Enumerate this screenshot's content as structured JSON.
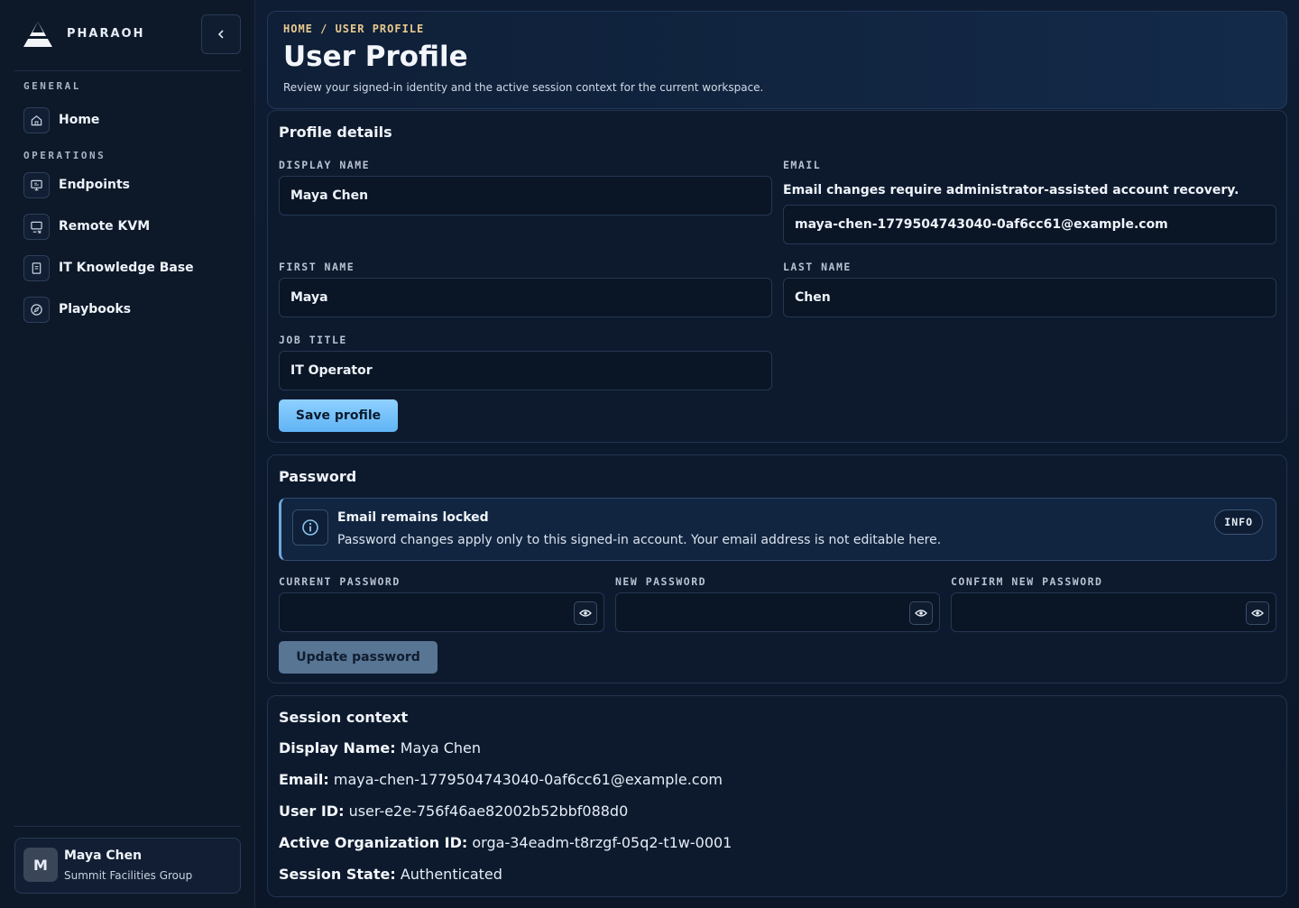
{
  "brand": {
    "name": "PHARAOH"
  },
  "sidebar": {
    "sections": [
      {
        "label": "GENERAL"
      },
      {
        "label": "OPERATIONS"
      }
    ],
    "items": [
      {
        "label": "Home",
        "icon": "home-icon"
      },
      {
        "label": "Endpoints",
        "icon": "monitor-icon"
      },
      {
        "label": "Remote KVM",
        "icon": "remote-screen-icon"
      },
      {
        "label": "IT Knowledge Base",
        "icon": "book-icon"
      },
      {
        "label": "Playbooks",
        "icon": "compass-icon"
      }
    ],
    "user": {
      "initial": "M",
      "name": "Maya Chen",
      "org": "Summit Facilities Group"
    }
  },
  "header": {
    "breadcrumb": "HOME / USER PROFILE",
    "title": "User Profile",
    "subtitle": "Review your signed-in identity and the active session context for the current workspace."
  },
  "profile": {
    "title": "Profile details",
    "display_name_label": "DISPLAY NAME",
    "display_name": "Maya Chen",
    "email_label": "EMAIL",
    "email_note": "Email changes require administrator-assisted account recovery.",
    "email": "maya-chen-1779504743040-0af6cc61@example.com",
    "first_name_label": "FIRST NAME",
    "first_name": "Maya",
    "last_name_label": "LAST NAME",
    "last_name": "Chen",
    "job_title_label": "JOB TITLE",
    "job_title": "IT Operator",
    "save_label": "Save profile"
  },
  "password": {
    "title": "Password",
    "alert_title": "Email remains locked",
    "alert_body": "Password changes apply only to this signed-in account. Your email address is not editable here.",
    "alert_badge": "INFO",
    "current_label": "CURRENT PASSWORD",
    "new_label": "NEW PASSWORD",
    "confirm_label": "CONFIRM NEW PASSWORD",
    "update_label": "Update password"
  },
  "session": {
    "title": "Session context",
    "rows": [
      {
        "key": "Display Name:",
        "value": "Maya Chen"
      },
      {
        "key": "Email:",
        "value": "maya-chen-1779504743040-0af6cc61@example.com"
      },
      {
        "key": "User ID:",
        "value": "user-e2e-756f46ae82002b52bbf088d0"
      },
      {
        "key": "Active Organization ID:",
        "value": "orga-34eadm-t8rzgf-05q2-t1w-0001"
      },
      {
        "key": "Session State:",
        "value": "Authenticated"
      }
    ]
  },
  "colors": {
    "accent": "#5fb4f5",
    "breadcrumb": "#e8c98e",
    "background": "#0b1628"
  }
}
